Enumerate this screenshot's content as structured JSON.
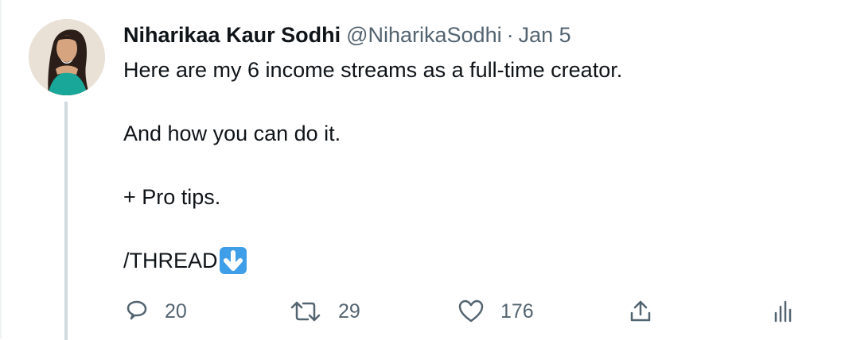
{
  "tweet": {
    "author": {
      "name": "Niharikaa Kaur Sodhi",
      "handle": "@NiharikaSodhi",
      "avatar": "profile-photo"
    },
    "separator": "·",
    "date": "Jan 5",
    "lines": [
      "Here are my 6 income streams as a full-time creator.",
      "And how you can do it.",
      "+ Pro tips.",
      "/THREAD"
    ],
    "thread_emoji": "down-arrow-button-icon"
  },
  "actions": {
    "reply": {
      "icon": "reply-icon",
      "count": "20"
    },
    "retweet": {
      "icon": "retweet-icon",
      "count": "29"
    },
    "like": {
      "icon": "heart-icon",
      "count": "176"
    },
    "share": {
      "icon": "share-icon"
    },
    "analytics": {
      "icon": "analytics-icon"
    }
  },
  "colors": {
    "text": "#0f1419",
    "secondary": "#536471",
    "thread_line": "#cfd9de",
    "emoji_blue": "#3f9ee8"
  }
}
